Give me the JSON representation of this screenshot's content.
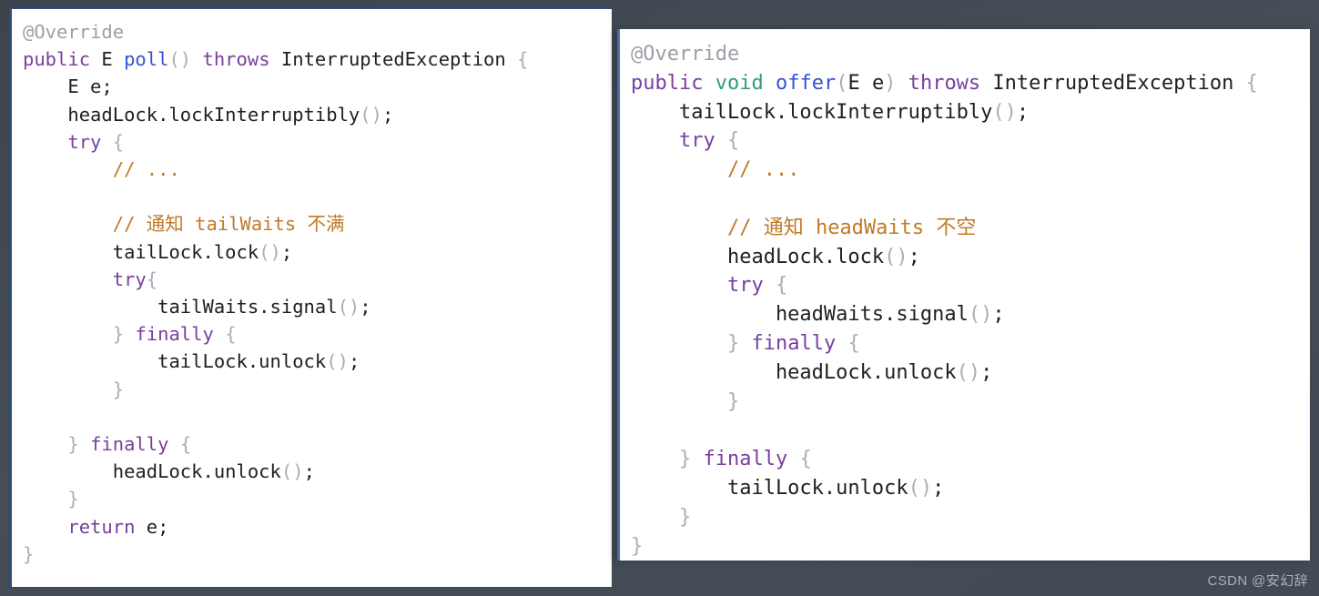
{
  "background_color": "#434a54",
  "watermark": {
    "text": "CSDN @安幻辞"
  },
  "panels": [
    {
      "id": "left",
      "name": "poll-code-panel",
      "language": "Java",
      "background_color": "#ffffff",
      "lines": [
        [
          {
            "t": "@Override",
            "c": "anno"
          }
        ],
        [
          {
            "t": "public",
            "c": "kw"
          },
          {
            "t": " ",
            "c": "plain"
          },
          {
            "t": "E",
            "c": "plain"
          },
          {
            "t": " ",
            "c": "plain"
          },
          {
            "t": "poll",
            "c": "method"
          },
          {
            "t": "()",
            "c": "punct"
          },
          {
            "t": " ",
            "c": "plain"
          },
          {
            "t": "throws",
            "c": "kw"
          },
          {
            "t": " InterruptedException ",
            "c": "plain"
          },
          {
            "t": "{",
            "c": "punct"
          }
        ],
        [
          {
            "t": "    E e;",
            "c": "plain"
          }
        ],
        [
          {
            "t": "    headLock.lockInterruptibly",
            "c": "plain"
          },
          {
            "t": "()",
            "c": "punct"
          },
          {
            "t": ";",
            "c": "plain"
          }
        ],
        [
          {
            "t": "    ",
            "c": "plain"
          },
          {
            "t": "try",
            "c": "kw"
          },
          {
            "t": " ",
            "c": "plain"
          },
          {
            "t": "{",
            "c": "punct"
          }
        ],
        [
          {
            "t": "        ",
            "c": "plain"
          },
          {
            "t": "// ...",
            "c": "comment"
          }
        ],
        [
          {
            "t": "",
            "c": "plain"
          }
        ],
        [
          {
            "t": "        ",
            "c": "plain"
          },
          {
            "t": "// 通知 tailWaits 不满",
            "c": "comment"
          }
        ],
        [
          {
            "t": "        tailLock.lock",
            "c": "plain"
          },
          {
            "t": "()",
            "c": "punct"
          },
          {
            "t": ";",
            "c": "plain"
          }
        ],
        [
          {
            "t": "        ",
            "c": "plain"
          },
          {
            "t": "try",
            "c": "kw"
          },
          {
            "t": "{",
            "c": "punct"
          }
        ],
        [
          {
            "t": "            tailWaits.signal",
            "c": "plain"
          },
          {
            "t": "()",
            "c": "punct"
          },
          {
            "t": ";",
            "c": "plain"
          }
        ],
        [
          {
            "t": "        ",
            "c": "plain"
          },
          {
            "t": "}",
            "c": "punct"
          },
          {
            "t": " ",
            "c": "plain"
          },
          {
            "t": "finally",
            "c": "kw"
          },
          {
            "t": " ",
            "c": "plain"
          },
          {
            "t": "{",
            "c": "punct"
          }
        ],
        [
          {
            "t": "            tailLock.unlock",
            "c": "plain"
          },
          {
            "t": "()",
            "c": "punct"
          },
          {
            "t": ";",
            "c": "plain"
          }
        ],
        [
          {
            "t": "        ",
            "c": "plain"
          },
          {
            "t": "}",
            "c": "punct"
          }
        ],
        [
          {
            "t": "",
            "c": "plain"
          }
        ],
        [
          {
            "t": "    ",
            "c": "plain"
          },
          {
            "t": "}",
            "c": "punct"
          },
          {
            "t": " ",
            "c": "plain"
          },
          {
            "t": "finally",
            "c": "kw"
          },
          {
            "t": " ",
            "c": "plain"
          },
          {
            "t": "{",
            "c": "punct"
          }
        ],
        [
          {
            "t": "        headLock.unlock",
            "c": "plain"
          },
          {
            "t": "()",
            "c": "punct"
          },
          {
            "t": ";",
            "c": "plain"
          }
        ],
        [
          {
            "t": "    ",
            "c": "plain"
          },
          {
            "t": "}",
            "c": "punct"
          }
        ],
        [
          {
            "t": "    ",
            "c": "plain"
          },
          {
            "t": "return",
            "c": "kw"
          },
          {
            "t": " e;",
            "c": "plain"
          }
        ],
        [
          {
            "t": "}",
            "c": "punct"
          }
        ]
      ]
    },
    {
      "id": "right",
      "name": "offer-code-panel",
      "language": "Java",
      "background_color": "#ffffff",
      "lines": [
        [
          {
            "t": "@Override",
            "c": "anno"
          }
        ],
        [
          {
            "t": "public",
            "c": "kw"
          },
          {
            "t": " ",
            "c": "plain"
          },
          {
            "t": "void",
            "c": "type"
          },
          {
            "t": " ",
            "c": "plain"
          },
          {
            "t": "offer",
            "c": "method"
          },
          {
            "t": "(",
            "c": "punct"
          },
          {
            "t": "E e",
            "c": "plain"
          },
          {
            "t": ")",
            "c": "punct"
          },
          {
            "t": " ",
            "c": "plain"
          },
          {
            "t": "throws",
            "c": "kw"
          },
          {
            "t": " InterruptedException ",
            "c": "plain"
          },
          {
            "t": "{",
            "c": "punct"
          }
        ],
        [
          {
            "t": "    tailLock.lockInterruptibly",
            "c": "plain"
          },
          {
            "t": "()",
            "c": "punct"
          },
          {
            "t": ";",
            "c": "plain"
          }
        ],
        [
          {
            "t": "    ",
            "c": "plain"
          },
          {
            "t": "try",
            "c": "kw"
          },
          {
            "t": " ",
            "c": "plain"
          },
          {
            "t": "{",
            "c": "punct"
          }
        ],
        [
          {
            "t": "        ",
            "c": "plain"
          },
          {
            "t": "// ...",
            "c": "comment"
          }
        ],
        [
          {
            "t": "",
            "c": "plain"
          }
        ],
        [
          {
            "t": "        ",
            "c": "plain"
          },
          {
            "t": "// 通知 headWaits 不空",
            "c": "comment"
          }
        ],
        [
          {
            "t": "        headLock.lock",
            "c": "plain"
          },
          {
            "t": "()",
            "c": "punct"
          },
          {
            "t": ";",
            "c": "plain"
          }
        ],
        [
          {
            "t": "        ",
            "c": "plain"
          },
          {
            "t": "try",
            "c": "kw"
          },
          {
            "t": " ",
            "c": "plain"
          },
          {
            "t": "{",
            "c": "punct"
          }
        ],
        [
          {
            "t": "            headWaits.signal",
            "c": "plain"
          },
          {
            "t": "()",
            "c": "punct"
          },
          {
            "t": ";",
            "c": "plain"
          }
        ],
        [
          {
            "t": "        ",
            "c": "plain"
          },
          {
            "t": "}",
            "c": "punct"
          },
          {
            "t": " ",
            "c": "plain"
          },
          {
            "t": "finally",
            "c": "kw"
          },
          {
            "t": " ",
            "c": "plain"
          },
          {
            "t": "{",
            "c": "punct"
          }
        ],
        [
          {
            "t": "            headLock.unlock",
            "c": "plain"
          },
          {
            "t": "()",
            "c": "punct"
          },
          {
            "t": ";",
            "c": "plain"
          }
        ],
        [
          {
            "t": "        ",
            "c": "plain"
          },
          {
            "t": "}",
            "c": "punct"
          }
        ],
        [
          {
            "t": "",
            "c": "plain"
          }
        ],
        [
          {
            "t": "    ",
            "c": "plain"
          },
          {
            "t": "}",
            "c": "punct"
          },
          {
            "t": " ",
            "c": "plain"
          },
          {
            "t": "finally",
            "c": "kw"
          },
          {
            "t": " ",
            "c": "plain"
          },
          {
            "t": "{",
            "c": "punct"
          }
        ],
        [
          {
            "t": "        tailLock.unlock",
            "c": "plain"
          },
          {
            "t": "()",
            "c": "punct"
          },
          {
            "t": ";",
            "c": "plain"
          }
        ],
        [
          {
            "t": "    ",
            "c": "plain"
          },
          {
            "t": "}",
            "c": "punct"
          }
        ],
        [
          {
            "t": "}",
            "c": "punct"
          }
        ]
      ]
    }
  ],
  "token_colors": {
    "plain": "#1f1f24",
    "kw": "#7a3e9d",
    "type": "#2e9e7e",
    "method": "#3552d4",
    "anno": "#9aa0a6",
    "punct": "#a9aeb5",
    "comment": "#c07a28"
  }
}
